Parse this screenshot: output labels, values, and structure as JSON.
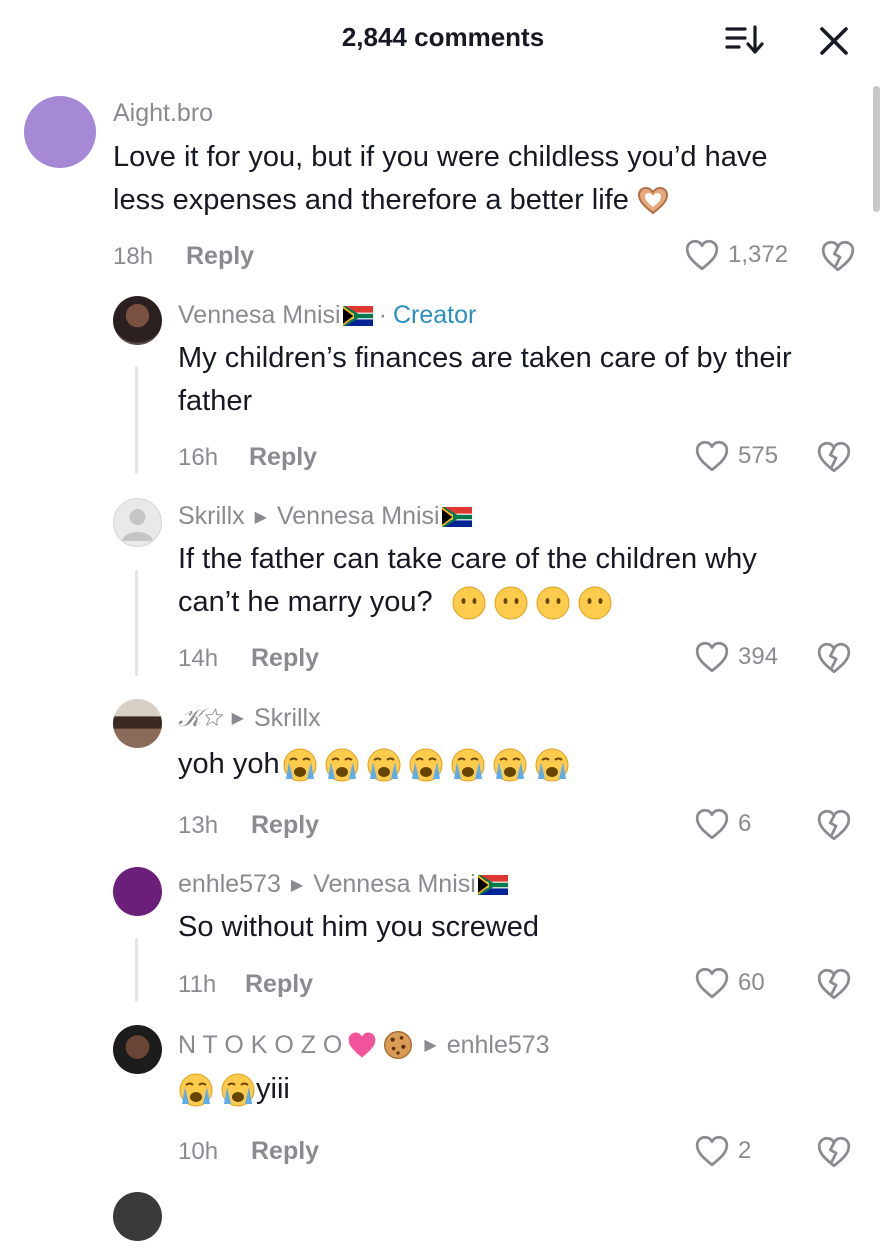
{
  "header": {
    "title": "2,844 comments",
    "sort_icon": "sort-descending-icon",
    "close_icon": "close-icon"
  },
  "comments": [
    {
      "username": "Aight.bro",
      "text_line1": "Love it for you, but if you were childless you’d have",
      "text_line2": "less expenses and therefore a better life",
      "time": "18h",
      "reply": "Reply",
      "likes": "1,372",
      "avatar_color": "#a589d6"
    },
    {
      "username": "Vennesa Mnisi",
      "creator_label": "Creator",
      "text_line1": "My children’s finances are taken care of by their",
      "text_line2": "father",
      "time": "16h",
      "reply": "Reply",
      "likes": "575"
    },
    {
      "username": "Skrillx",
      "reply_to": "Vennesa Mnisi",
      "text_line1": "If the father can take care of the children why",
      "text_line2": "can’t he marry you?",
      "time": "14h",
      "reply": "Reply",
      "likes": "394"
    },
    {
      "username": "𝒦☆",
      "reply_to": "Skrillx",
      "text_line1": "yoh yoh",
      "time": "13h",
      "reply": "Reply",
      "likes": "6"
    },
    {
      "username": "enhle573",
      "reply_to": "Vennesa Mnisi",
      "text_line1": "So without him you screwed",
      "time": "11h",
      "reply": "Reply",
      "likes": "60",
      "avatar_color": "#6b1f7a"
    },
    {
      "username": "N T O K O Z O",
      "reply_to": "enhle573",
      "text_line1": "yiii",
      "time": "10h",
      "reply": "Reply",
      "likes": "2"
    }
  ]
}
